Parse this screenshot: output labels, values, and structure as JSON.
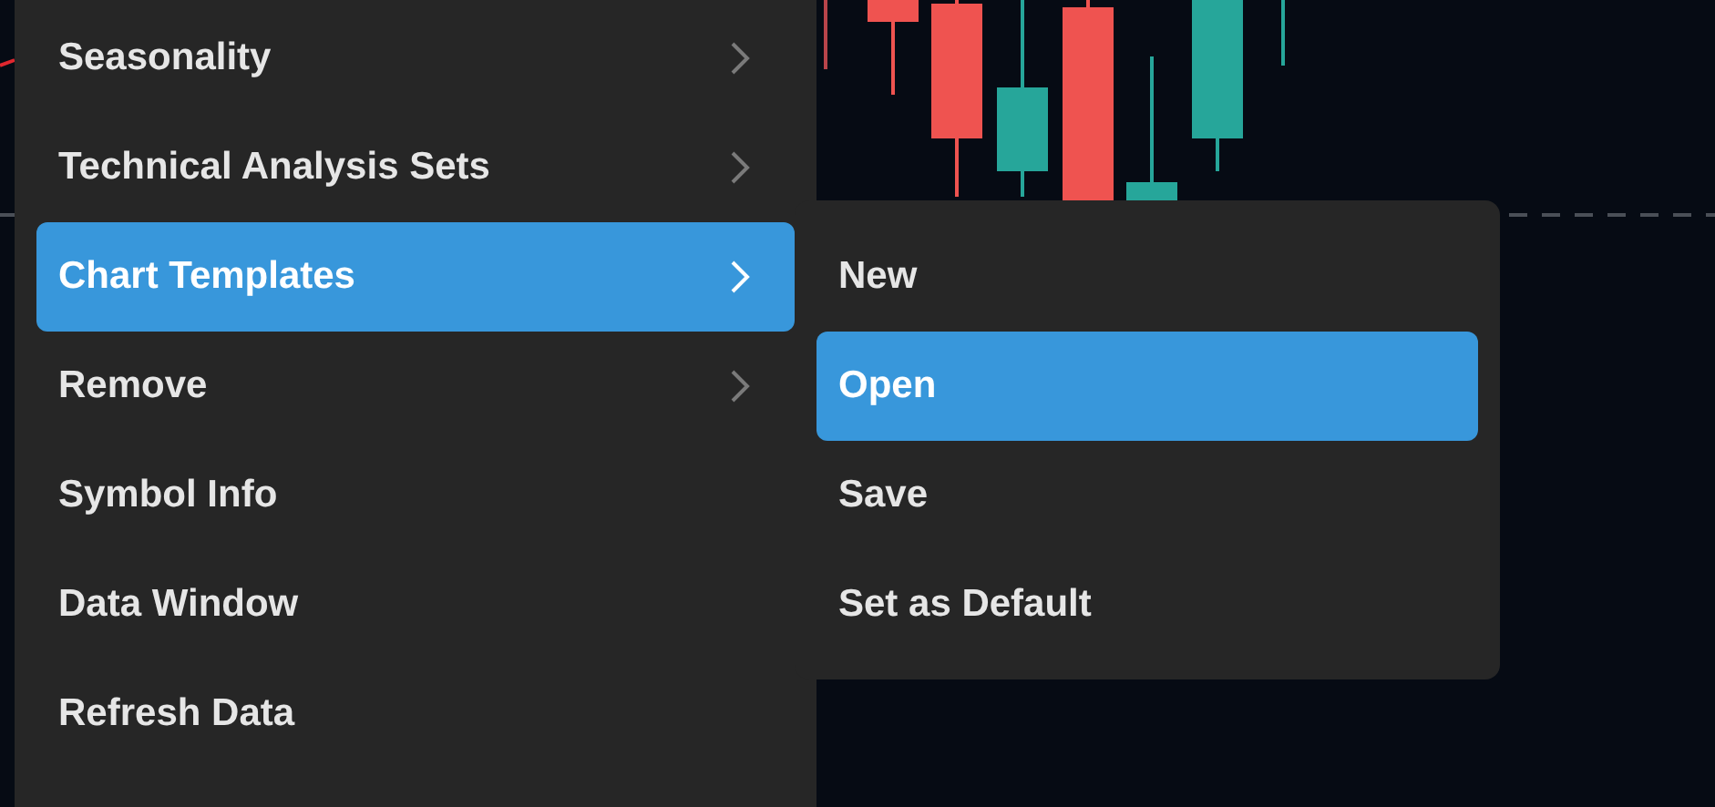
{
  "context_menu": {
    "items": [
      {
        "label": "Seasonality",
        "has_submenu": true,
        "selected": false
      },
      {
        "label": "Technical Analysis Sets",
        "has_submenu": true,
        "selected": false
      },
      {
        "label": "Chart Templates",
        "has_submenu": true,
        "selected": true
      },
      {
        "label": "Remove",
        "has_submenu": true,
        "selected": false
      },
      {
        "label": "Symbol Info",
        "has_submenu": false,
        "selected": false
      },
      {
        "label": "Data Window",
        "has_submenu": false,
        "selected": false
      },
      {
        "label": "Refresh Data",
        "has_submenu": false,
        "selected": false
      }
    ]
  },
  "submenu": {
    "items": [
      {
        "label": "New",
        "selected": false
      },
      {
        "label": "Open",
        "selected": true
      },
      {
        "label": "Save",
        "selected": false
      },
      {
        "label": "Set as Default",
        "selected": false
      }
    ]
  }
}
